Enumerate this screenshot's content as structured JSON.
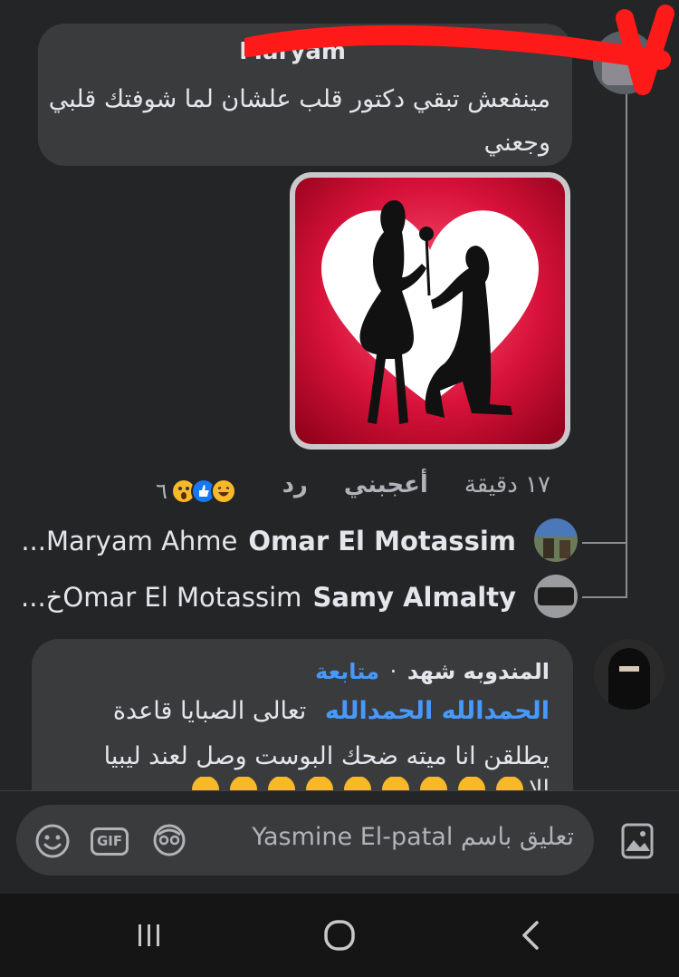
{
  "comment1": {
    "author": "Maryam",
    "text": "مينفعش تبقي دكتور قلب علشان لما شوفتك قلبي وجعني",
    "time": "١٧ دقيقة",
    "like_label": "أعجبني",
    "reply_label": "رد",
    "reactions_count": "٦",
    "reaction_icons": [
      "haha-icon",
      "like-icon",
      "wow-icon"
    ]
  },
  "replies": [
    {
      "name": "Omar El Motassim",
      "text": "Maryam Ahme..."
    },
    {
      "name": "Samy Almalty",
      "text": "Omar El Motassimخ..."
    }
  ],
  "comment2": {
    "author": "المندوبه شهد",
    "separator": "·",
    "follow_label": "متابعة",
    "tag": "الحمدالله الحمدالله",
    "line1": "تعالى الصبايا قاعدة",
    "line2": "يطلقن انا ميته ضحك البوست وصل لعند ليبيا",
    "line3_prefix": "الا"
  },
  "composer": {
    "placeholder": "تعليق باسم Yasmine El-patal",
    "gif_label": "GIF"
  },
  "colors": {
    "background": "#242526",
    "bubble": "#3a3b3c",
    "link": "#4599ff",
    "redact": "#ff1a1a"
  }
}
